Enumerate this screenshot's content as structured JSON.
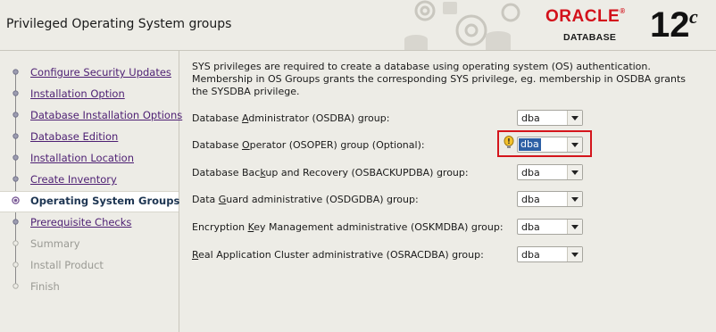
{
  "window": {
    "title": "Privileged Operating System groups"
  },
  "logo": {
    "brand": "ORACLE",
    "registered": "®",
    "product": "DATABASE",
    "version": "12",
    "version_suffix": "c"
  },
  "sidebar": {
    "steps": [
      {
        "label": "Configure Security Updates",
        "state": "done"
      },
      {
        "label": "Installation Option",
        "state": "done"
      },
      {
        "label": "Database Installation Options",
        "state": "done"
      },
      {
        "label": "Database Edition",
        "state": "done"
      },
      {
        "label": "Installation Location",
        "state": "done"
      },
      {
        "label": "Create Inventory",
        "state": "done"
      },
      {
        "label": "Operating System Groups",
        "state": "current"
      },
      {
        "label": "Prerequisite Checks",
        "state": "upcoming"
      },
      {
        "label": "Summary",
        "state": "pending"
      },
      {
        "label": "Install Product",
        "state": "pending"
      },
      {
        "label": "Finish",
        "state": "pending"
      }
    ]
  },
  "main": {
    "description": "SYS privileges are required to create a database using operating system (OS) authentication. Membership in OS Groups grants the corresponding SYS privilege, eg. membership in OSDBA grants the SYSDBA privilege.",
    "groups": [
      {
        "pre": "Database ",
        "key": "A",
        "post": "dministrator (OSDBA) group:",
        "value": "dba"
      },
      {
        "pre": "Database ",
        "key": "O",
        "post": "perator (OSOPER) group (Optional):",
        "value": "dba"
      },
      {
        "pre": "Database Bac",
        "key": "k",
        "post": "up and Recovery (OSBACKUPDBA) group:",
        "value": "dba"
      },
      {
        "pre": "Data ",
        "key": "G",
        "post": "uard administrative (OSDGDBA) group:",
        "value": "dba"
      },
      {
        "pre": "Encryption ",
        "key": "K",
        "post": "ey Management administrative (OSKMDBA) group:",
        "value": "dba"
      },
      {
        "pre": "",
        "key": "R",
        "post": "eal Application Cluster administrative (OSRACDBA) group:",
        "value": "dba"
      }
    ]
  },
  "colors": {
    "accent_red": "#d4151c",
    "oracle_red": "#d3111b",
    "link_purple": "#4d1f73",
    "selection_blue": "#2d5fa5"
  }
}
